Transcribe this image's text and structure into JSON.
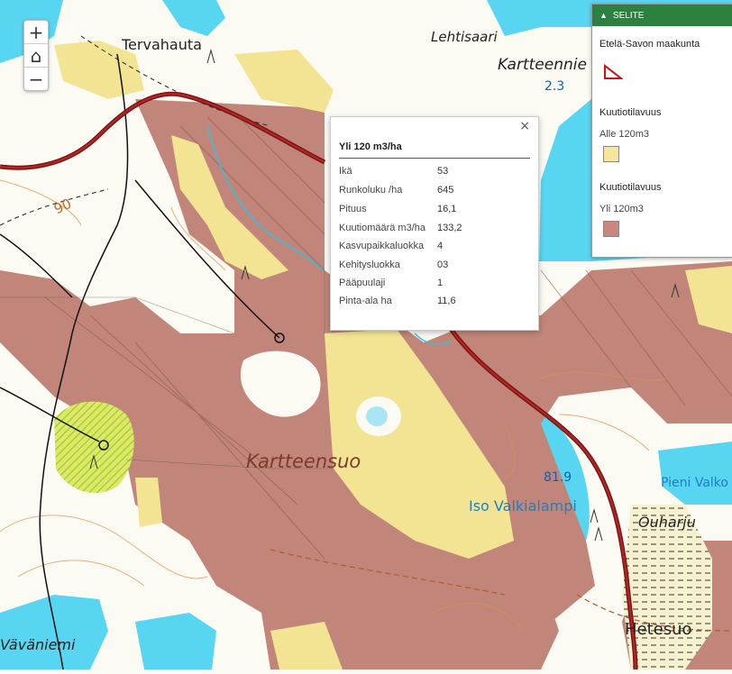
{
  "map": {
    "place_labels": [
      "Tervahauta",
      "Lehtisaari",
      "Kartteennie",
      "2.3",
      "90",
      "Kartteensuo",
      "81.9",
      "Iso Valkialampi",
      "Pieni Valko",
      "Ouharju",
      "Hetesuo",
      "Väväniemi"
    ]
  },
  "zoom": {
    "in": "+",
    "home": "⌂",
    "out": "−"
  },
  "popup": {
    "close": "×",
    "title": "Yli 120 m3/ha",
    "rows": [
      {
        "label": "Ikä",
        "value": "53"
      },
      {
        "label": "Runkoluku /ha",
        "value": "645"
      },
      {
        "label": "Pituus",
        "value": "16,1"
      },
      {
        "label": "Kuutiomäärä m3/ha",
        "value": "133,2"
      },
      {
        "label": "Kasvupaikkaluokka",
        "value": "4"
      },
      {
        "label": "Kehitysluokka",
        "value": "03"
      },
      {
        "label": "Pääpuulaji",
        "value": "1"
      },
      {
        "label": "Pinta-ala ha",
        "value": "11,6"
      }
    ]
  },
  "legend": {
    "header": "SELITE",
    "region_title": "Etelä-Savon maakunta",
    "group1_title": "Kuutiotilavuus",
    "group1_item": "Alle 120m3",
    "group2_title": "Kuutiotilavuus",
    "group2_item": "Yli 120m3",
    "colors": {
      "alle": "#f7e59c",
      "yli": "#c9877d",
      "region_outline": "#cc1111"
    }
  },
  "colors": {
    "water": "#56d4f0",
    "forest_high": "#bf867a",
    "forest_low": "#f3e494",
    "road": "#7a1515",
    "header_green": "#2d8040"
  }
}
